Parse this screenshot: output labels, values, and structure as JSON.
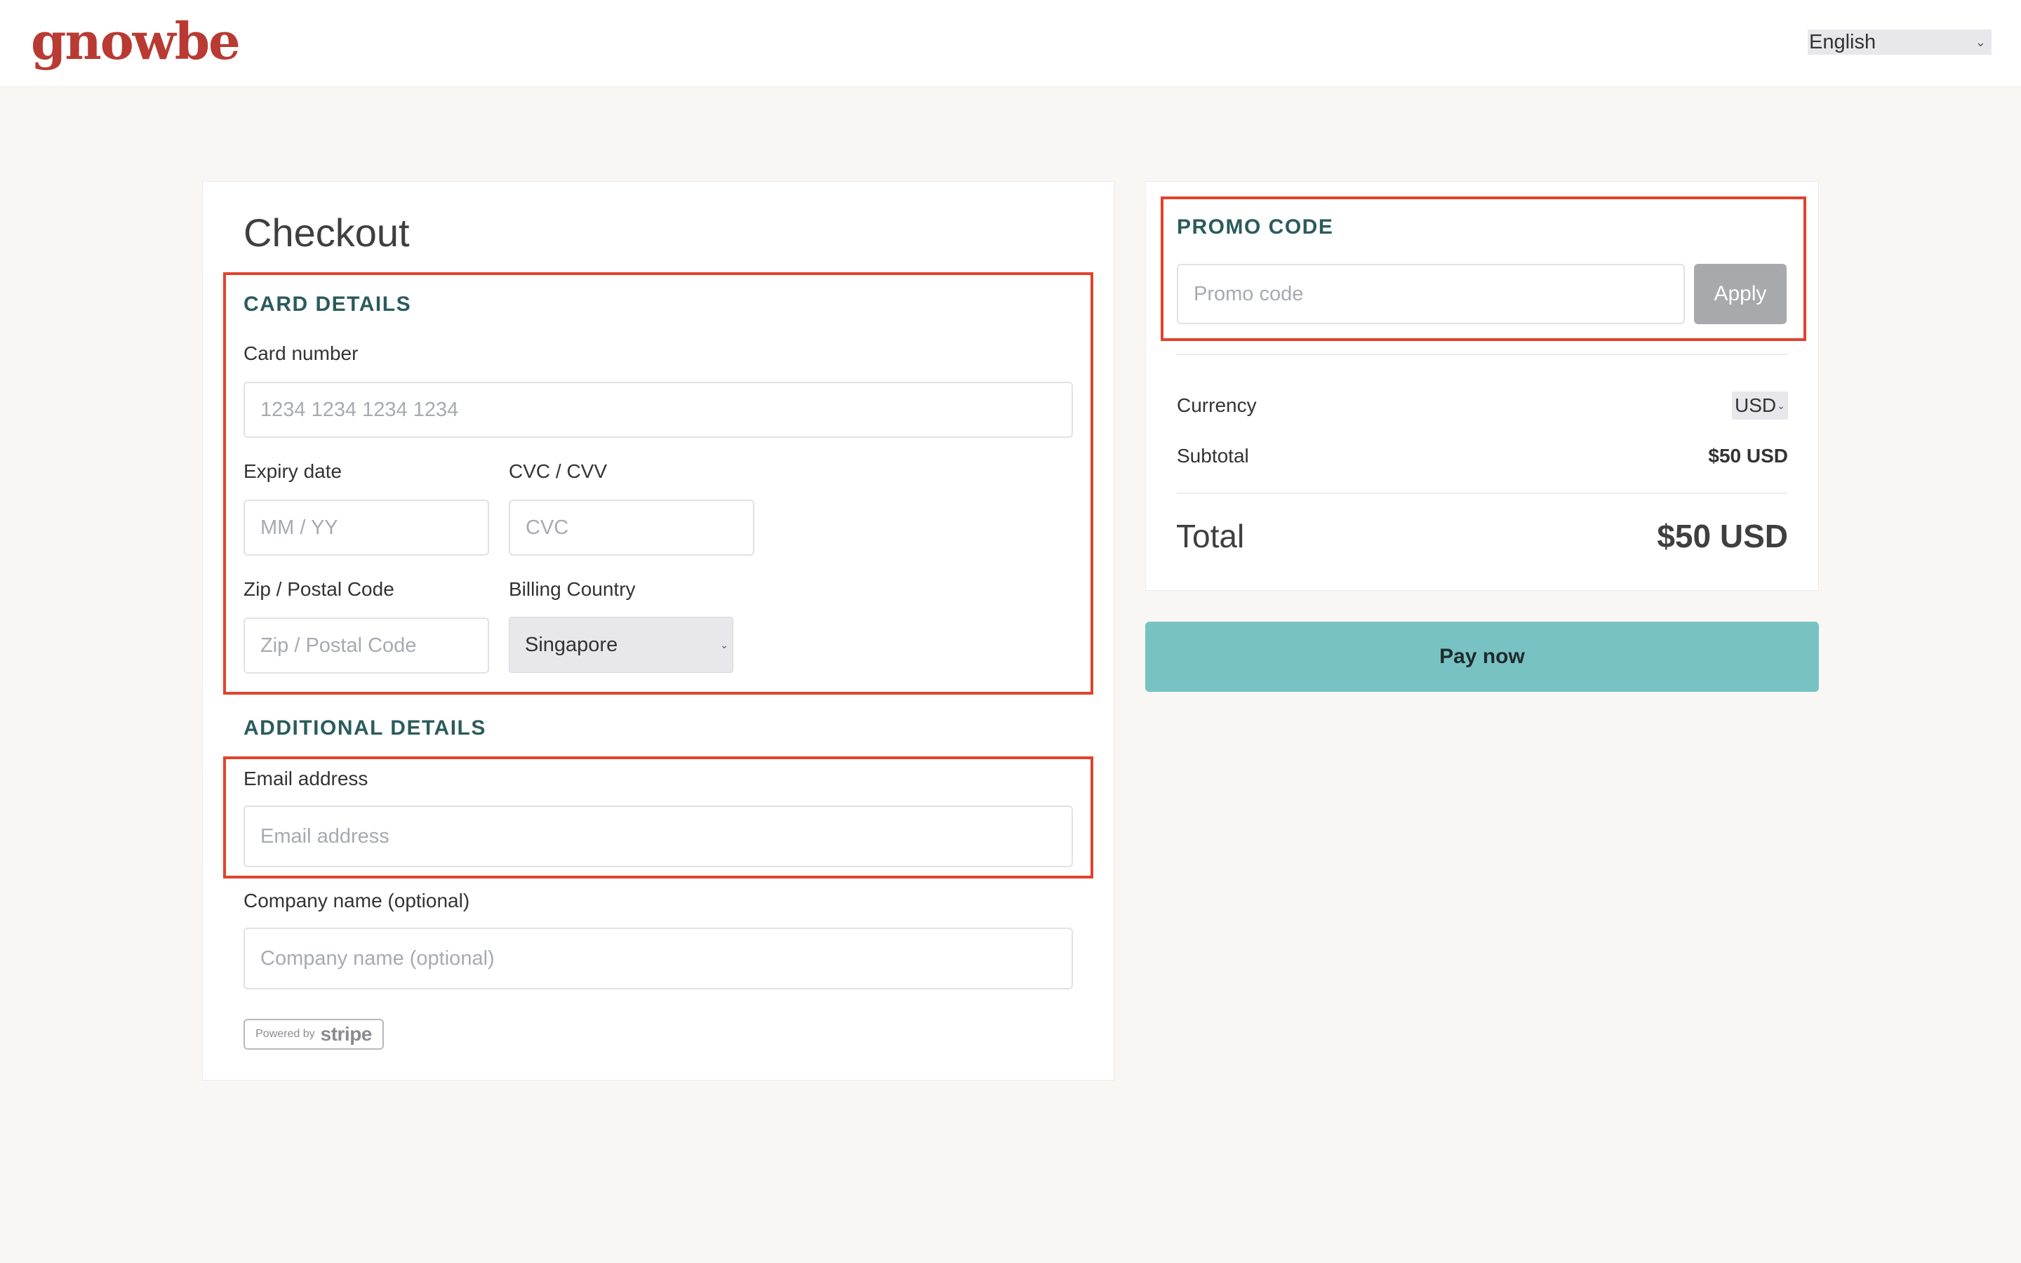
{
  "header": {
    "logo_text": "gnowbe",
    "language": {
      "selected": "English"
    }
  },
  "checkout": {
    "title": "Checkout",
    "card_details": {
      "heading": "CARD DETAILS",
      "card_number": {
        "label": "Card number",
        "placeholder": "1234 1234 1234 1234",
        "value": ""
      },
      "expiry": {
        "label": "Expiry date",
        "placeholder": "MM / YY",
        "value": ""
      },
      "cvc": {
        "label": "CVC / CVV",
        "placeholder": "CVC",
        "value": ""
      },
      "zip": {
        "label": "Zip / Postal Code",
        "placeholder": "Zip / Postal Code",
        "value": ""
      },
      "country": {
        "label": "Billing Country",
        "selected": "Singapore"
      }
    },
    "additional_details": {
      "heading": "ADDITIONAL DETAILS",
      "email": {
        "label": "Email address",
        "placeholder": "Email address",
        "value": ""
      },
      "company": {
        "label": "Company name (optional)",
        "placeholder": "Company name (optional)",
        "value": ""
      }
    },
    "stripe_badge": {
      "powered_by": "Powered by",
      "brand": "stripe"
    }
  },
  "summary": {
    "promo": {
      "heading": "PROMO CODE",
      "placeholder": "Promo code",
      "value": "",
      "apply_label": "Apply"
    },
    "currency": {
      "label": "Currency",
      "selected": "USD"
    },
    "subtotal": {
      "label": "Subtotal",
      "value": "$50 USD"
    },
    "total": {
      "label": "Total",
      "value": "$50 USD"
    },
    "pay_label": "Pay now"
  },
  "colors": {
    "brand": "#b83a33",
    "heading": "#2b5b5c",
    "pay_button": "#79c2c4",
    "highlight": "#e1432d",
    "apply_button": "#a8a9ad"
  }
}
